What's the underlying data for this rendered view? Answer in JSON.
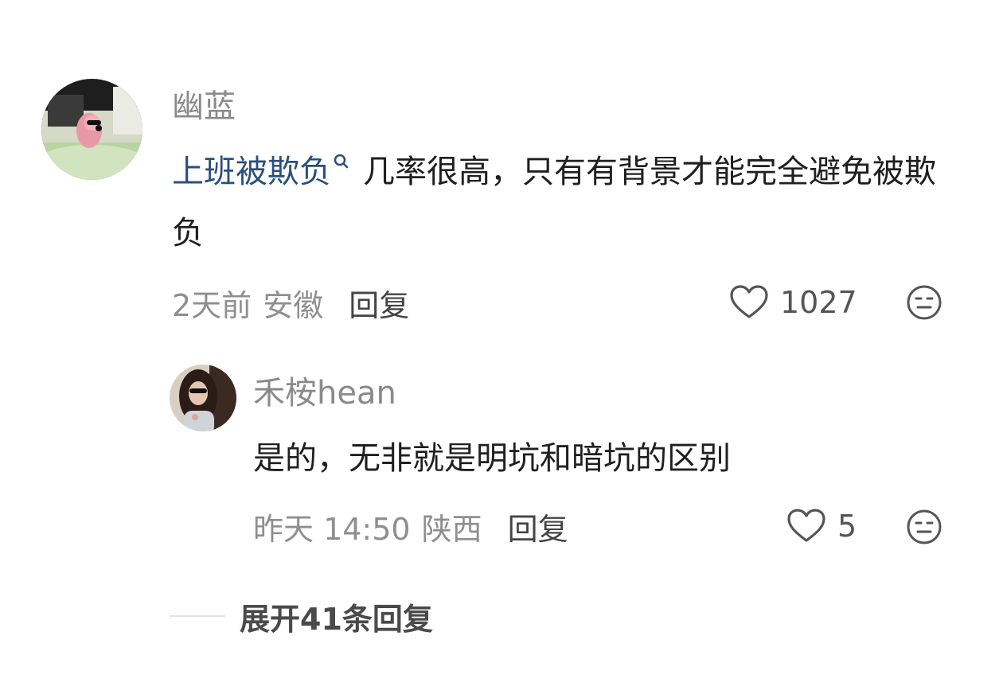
{
  "comment": {
    "username": "幽蓝",
    "link_text": "上班被欺负",
    "link_icon": "search-icon",
    "body_text": "几率很高，只有有背景才能完全避免被欺负",
    "time": "2天前",
    "location": "安徽",
    "reply_label": "回复",
    "likes": "1027"
  },
  "reply": {
    "username": "禾桉hean",
    "body_text": "是的，无非就是明坑和暗坑的区别",
    "time": "昨天 14:50",
    "location": "陕西",
    "reply_label": "回复",
    "likes": "5"
  },
  "expand_replies": {
    "label": "展开41条回复"
  },
  "colors": {
    "link": "#2b4f7e",
    "text": "#1f1f1f",
    "meta": "#8f8f8f"
  }
}
